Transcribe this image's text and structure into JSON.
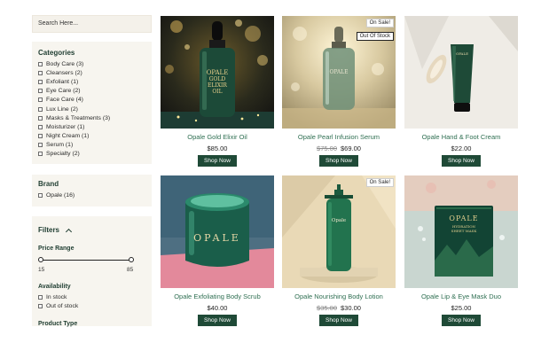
{
  "search": {
    "placeholder": "Search Here..."
  },
  "categories": {
    "title": "Categories",
    "items": [
      "Body Care (3)",
      "Cleansers (2)",
      "Exfoliant (1)",
      "Eye Care (2)",
      "Face Care (4)",
      "Lux Line (2)",
      "Masks & Treatments (3)",
      "Moisturizer (1)",
      "Night Cream (1)",
      "Serum (1)",
      "Specialty (2)"
    ]
  },
  "brand": {
    "title": "Brand",
    "items": [
      "Opale (16)"
    ]
  },
  "filters": {
    "title": "Filters",
    "price_range": {
      "label": "Price Range",
      "min": "15",
      "max": "85",
      "low": 15,
      "high": 85
    },
    "availability": {
      "label": "Availability",
      "items": [
        "In stock",
        "Out of stock"
      ]
    },
    "product_type": {
      "label": "Product Type"
    }
  },
  "products": [
    {
      "name": "Opale Gold Elixir Oil",
      "price": "$85.00",
      "old_price": "",
      "button": "Shop Now",
      "badges": []
    },
    {
      "name": "Opale Pearl Infusion Serum",
      "price": "$69.00",
      "old_price": "$75.00",
      "button": "Shop Now",
      "badges": [
        "On Sale!",
        "Out Of Stock"
      ]
    },
    {
      "name": "Opale Hand & Foot Cream",
      "price": "$22.00",
      "old_price": "",
      "button": "Shop Now",
      "badges": []
    },
    {
      "name": "Opale Exfoliating Body Scrub",
      "price": "$40.00",
      "old_price": "",
      "button": "Shop Now",
      "badges": []
    },
    {
      "name": "Opale Nourishing Body Lotion",
      "price": "$30.00",
      "old_price": "$35.00",
      "button": "Shop Now",
      "badges": [
        "On Sale!"
      ]
    },
    {
      "name": "Opale Lip & Eye Mask Duo",
      "price": "$25.00",
      "old_price": "",
      "button": "Shop Now",
      "badges": []
    }
  ],
  "image_text": {
    "p1": [
      "OPALE",
      "GOLD",
      "ELIXIR",
      "OIL"
    ],
    "p2": [
      "OPALE"
    ],
    "p3": [
      "OPALE"
    ],
    "p4": [
      "OPALE"
    ],
    "p5": [
      "Opale"
    ],
    "p6": [
      "OPALE",
      "HYDRATION",
      "SHEET MASK"
    ]
  },
  "colors": {
    "accent": "#1f4a37",
    "link": "#2f6f52",
    "panel": "#f7f5ef"
  }
}
